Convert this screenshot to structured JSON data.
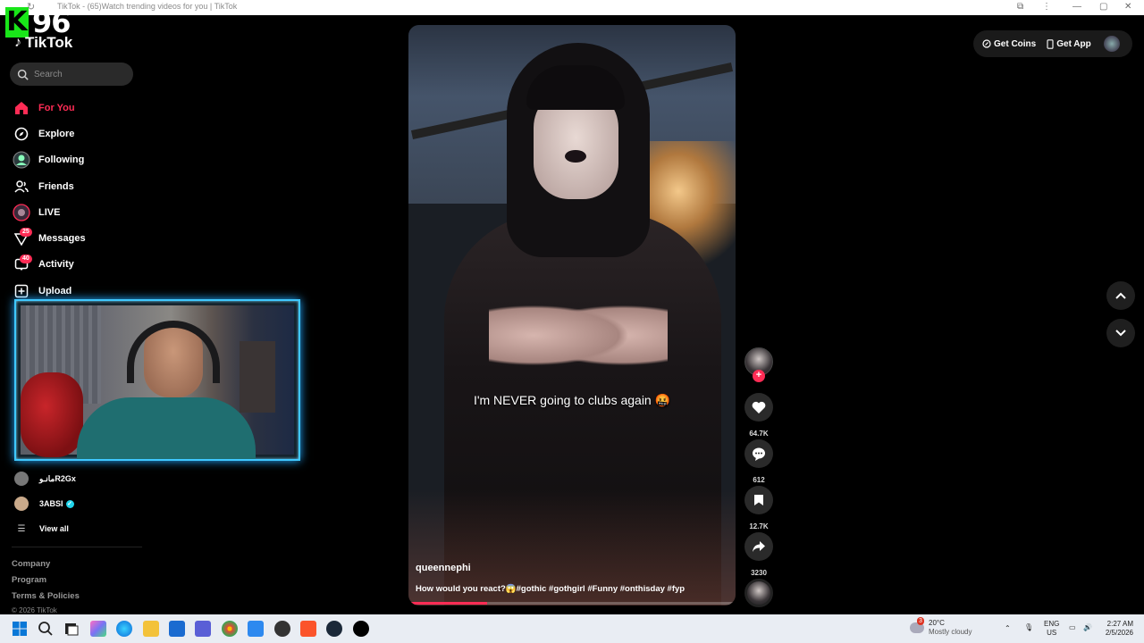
{
  "browser": {
    "title": "TikTok - (65)Watch trending videos for you | TikTok"
  },
  "overlay": {
    "logo_k": "K",
    "logo_num": "96"
  },
  "app": {
    "name": "TikTok"
  },
  "search": {
    "placeholder": "Search"
  },
  "nav": {
    "items": [
      {
        "label": "For You",
        "icon": "home-icon",
        "active": true
      },
      {
        "label": "Explore",
        "icon": "compass-icon"
      },
      {
        "label": "Following",
        "icon": "following-avatar-icon"
      },
      {
        "label": "Friends",
        "icon": "friends-icon"
      },
      {
        "label": "LIVE",
        "icon": "live-icon"
      },
      {
        "label": "Messages",
        "icon": "messages-icon",
        "badge": "25"
      },
      {
        "label": "Activity",
        "icon": "activity-icon",
        "badge": "40"
      },
      {
        "label": "Upload",
        "icon": "upload-icon"
      }
    ]
  },
  "following_accounts": [
    {
      "name": "مانـوR2Gx"
    },
    {
      "name": "3ABSI",
      "verified": true
    }
  ],
  "view_all": "View all",
  "footer": {
    "links": [
      "Company",
      "Program",
      "Terms & Policies"
    ],
    "copyright": "© 2026 TikTok"
  },
  "video": {
    "caption": "I'm NEVER going to clubs again 🤬",
    "author": "queennephi",
    "description": "How would you react?😱#gothic #gothgirl #Funny #onthisday #fyp",
    "progress": 0.24
  },
  "actions": {
    "likes": "64.7K",
    "comments": "612",
    "bookmarks": "12.7K",
    "shares": "3230"
  },
  "header": {
    "get_coins": "Get Coins",
    "get_app": "Get App"
  },
  "taskbar": {
    "weather_badge": "3",
    "temp": "20°C",
    "condition": "Mostly cloudy",
    "lang": "ENG",
    "region": "US",
    "time": "2:27 AM",
    "date": "2/5/2026"
  },
  "colors": {
    "accent": "#fe2c55",
    "cam_border": "#3fc8ff",
    "bg": "#000000"
  }
}
